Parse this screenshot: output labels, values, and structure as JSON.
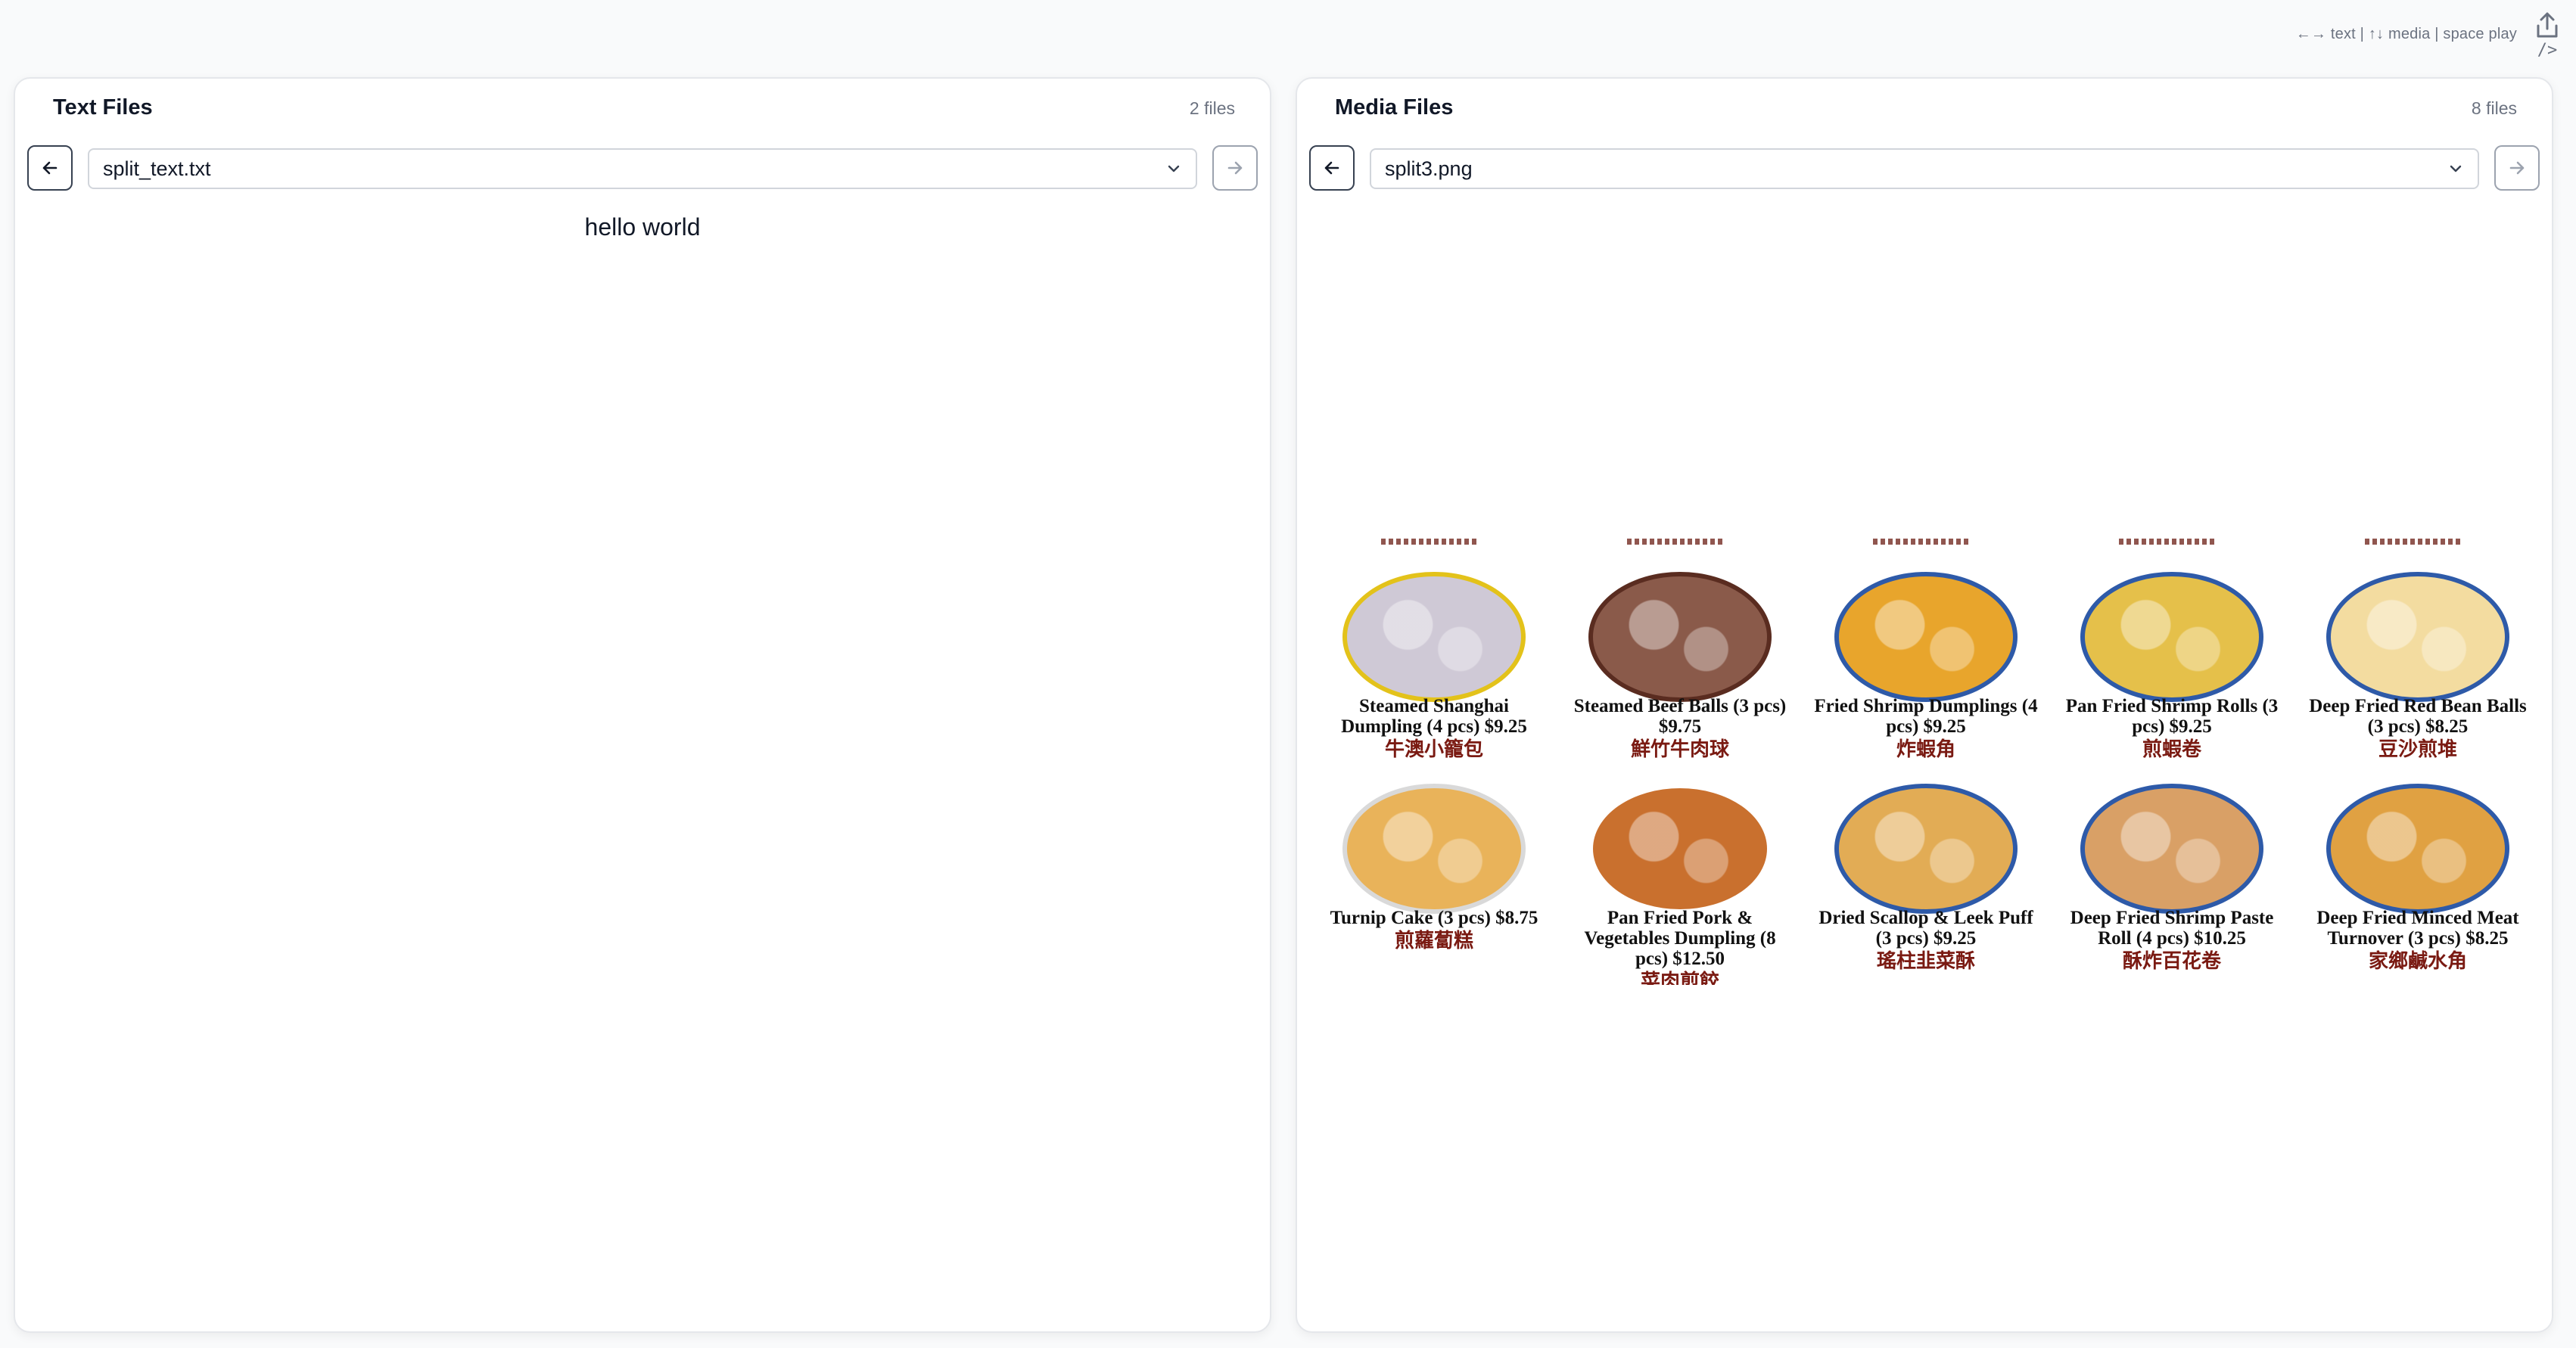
{
  "hint": "←→ text | ↑↓ media | space play",
  "top_icons": {
    "share": "share-upload-icon",
    "embed": "/>"
  },
  "text_panel": {
    "title": "Text Files",
    "count": "2 files",
    "selected_file": "split_text.txt",
    "content": "hello world"
  },
  "media_panel": {
    "title": "Media Files",
    "count": "8 files",
    "selected_file": "split3.png",
    "menu": {
      "row1": [
        {
          "name": "Steamed Shanghai Dumpling (4 pcs) $9.25",
          "chinese": "牛澳小籠包",
          "color": "#cfc9d6",
          "rim": "#e3c21a"
        },
        {
          "name": "Steamed Beef Balls (3 pcs) $9.75",
          "chinese": "鮮竹牛肉球",
          "color": "#8a5a4a",
          "rim": "#5a2c20"
        },
        {
          "name": "Fried Shrimp Dumplings (4 pcs) $9.25",
          "chinese": "炸蝦角",
          "color": "#e8a52c",
          "rim": "#2e5aa8"
        },
        {
          "name": "Pan Fried Shrimp Rolls (3 pcs) $9.25",
          "chinese": "煎蝦卷",
          "color": "#e5c04a",
          "rim": "#2e5aa8"
        },
        {
          "name": "Deep Fried Red Bean Balls (3 pcs) $8.25",
          "chinese": "豆沙煎堆",
          "color": "#f3dca0",
          "rim": "#2e5aa8"
        }
      ],
      "row2": [
        {
          "name": "Turnip Cake (3 pcs) $8.75",
          "chinese": "煎蘿蔔糕",
          "color": "#e9b35a",
          "rim": "#d9d9d9"
        },
        {
          "name": "Pan Fried Pork & Vegetables Dumpling (8 pcs) $12.50",
          "chinese": "菜肉煎餃",
          "color": "#c9702e",
          "rim": "#ffffff"
        },
        {
          "name": "Dried Scallop & Leek Puff (3 pcs) $9.25",
          "chinese": "瑤柱韭菜酥",
          "color": "#e2ac55",
          "rim": "#2e5aa8"
        },
        {
          "name": "Deep Fried Shrimp Paste Roll (4 pcs) $10.25",
          "chinese": "酥炸百花卷",
          "color": "#d9a066",
          "rim": "#2e5aa8"
        },
        {
          "name": "Deep Fried Minced Meat Turnover (3 pcs) $8.25",
          "chinese": "家鄉鹹水角",
          "color": "#e0a142",
          "rim": "#2e5aa8"
        }
      ]
    }
  }
}
